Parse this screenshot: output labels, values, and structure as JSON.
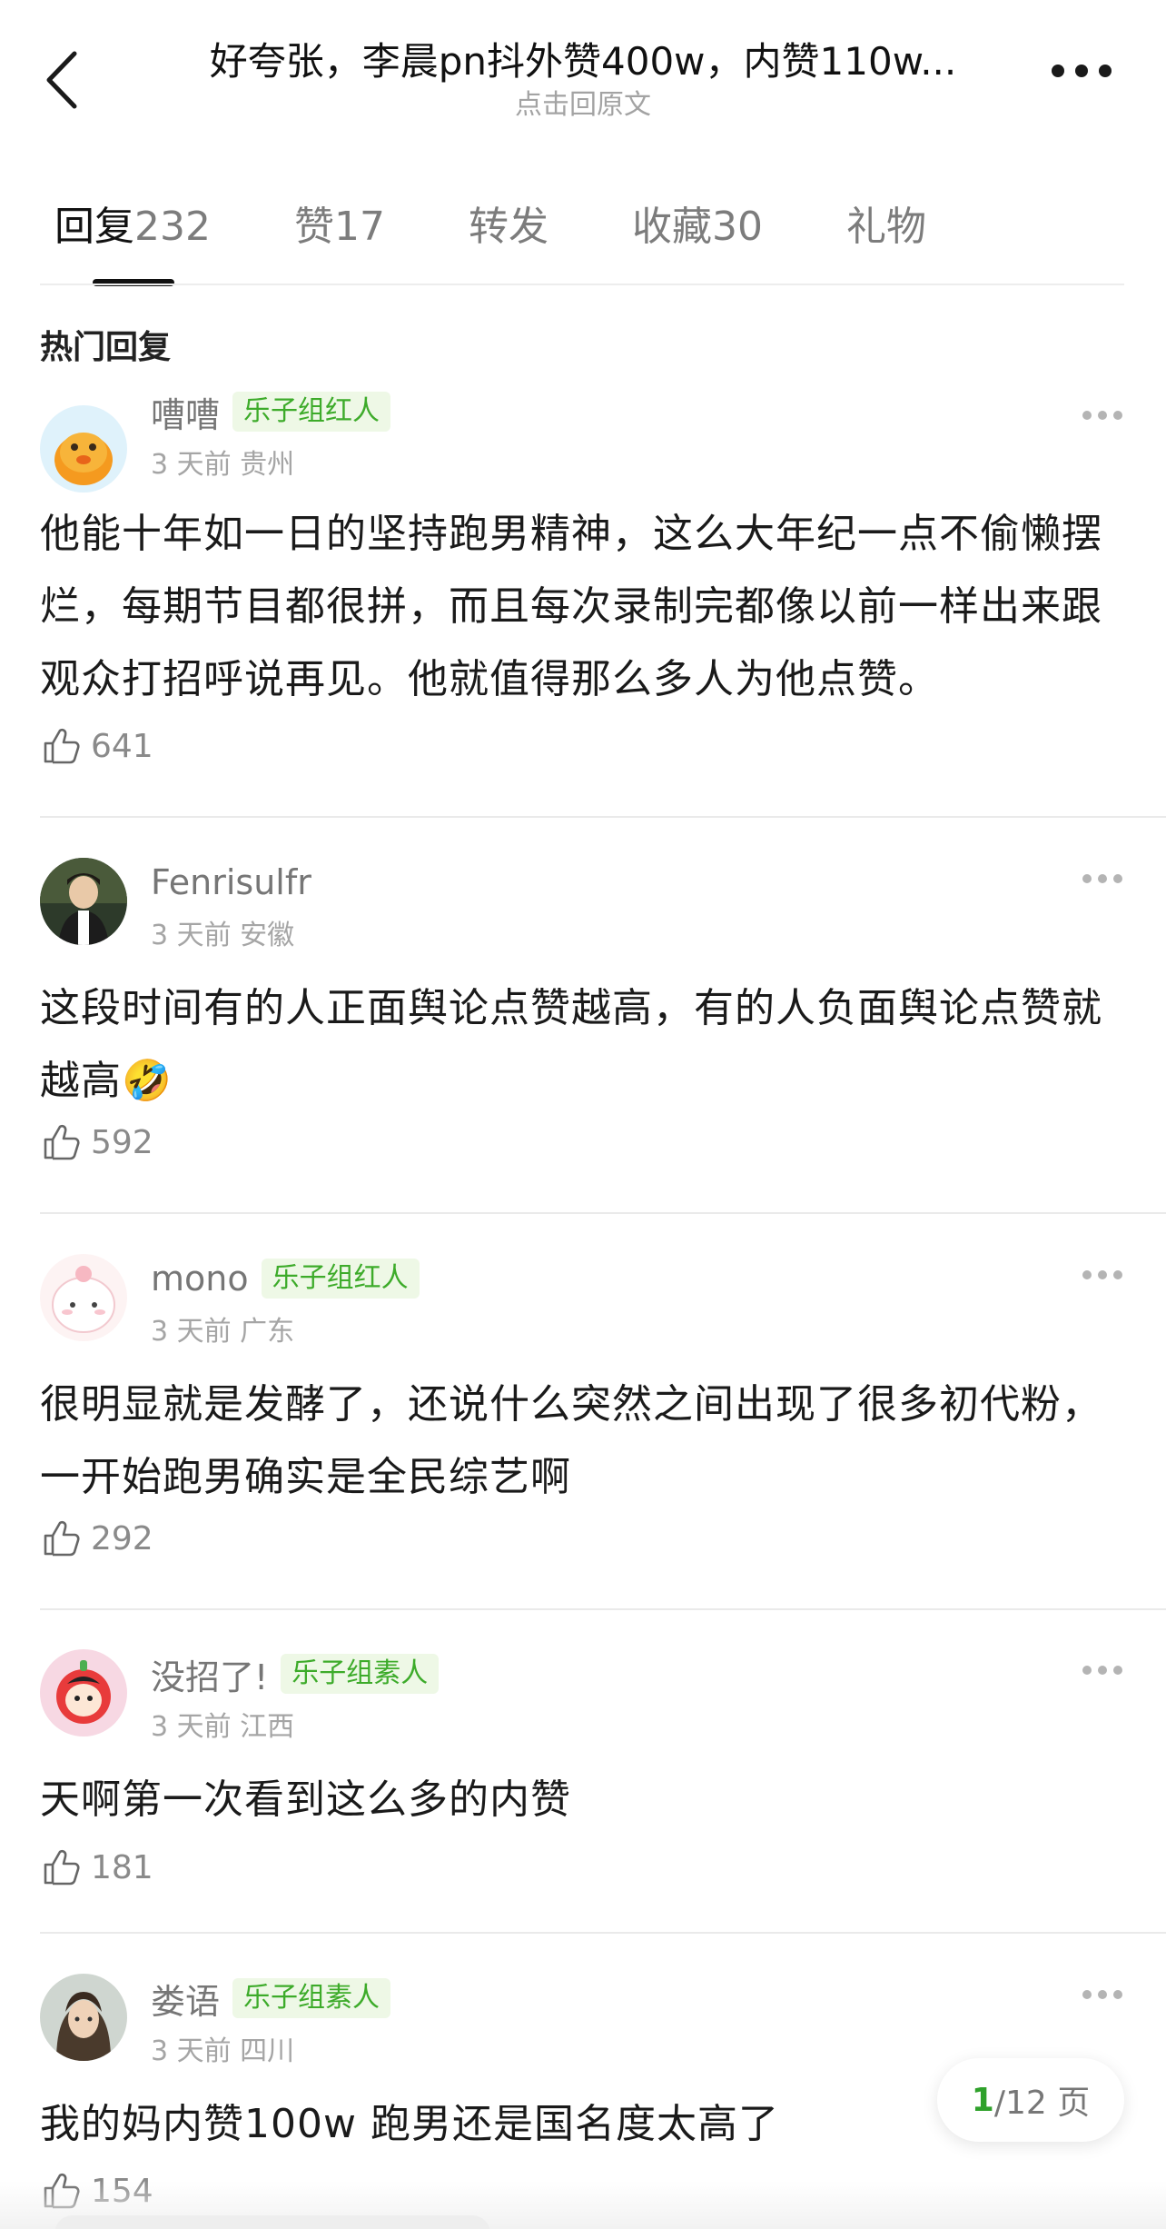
{
  "header": {
    "title": "好夸张，李晨pn抖外赞400w，内赞110w...",
    "subtitle": "点击回原文"
  },
  "tabs": [
    {
      "name": "回复",
      "count": "232"
    },
    {
      "name": "赞",
      "count": "17"
    },
    {
      "name": "转发",
      "count": ""
    },
    {
      "name": "收藏",
      "count": "30"
    },
    {
      "name": "礼物",
      "count": ""
    }
  ],
  "section_title": "热门回复",
  "comments": [
    {
      "username": "嘈嘈",
      "badge": "乐子组红人",
      "time_location": "3 天前  贵州",
      "text": "他能十年如一日的坚持跑男精神，这么大年纪一点不偷懒摆烂，每期节目都很拼，而且每次录制完都像以前一样出来跟观众打招呼说再见。他就值得那么多人为他点赞。",
      "likes": "641"
    },
    {
      "username": "Fenrisulfr",
      "badge": "",
      "time_location": "3 天前  安徽",
      "text": "这段时间有的人正面舆论点赞越高，有的人负面舆论点赞就越高🤣",
      "likes": "592"
    },
    {
      "username": "mono",
      "badge": "乐子组红人",
      "time_location": "3 天前  广东",
      "text": "很明显就是发酵了，还说什么突然之间出现了很多初代粉，一开始跑男确实是全民综艺啊",
      "likes": "292"
    },
    {
      "username": "没招了!",
      "badge": "乐子组素人",
      "time_location": "3 天前  江西",
      "text": "天啊第一次看到这么多的内赞",
      "likes": "181"
    },
    {
      "username": "娄语",
      "badge": "乐子组素人",
      "time_location": "3 天前  四川",
      "text": "我的妈内赞100w 跑男还是国名度太高了",
      "likes": "154"
    }
  ],
  "pagination": {
    "current": "1",
    "rest": "/12 页"
  },
  "colors": {
    "accent_green": "#3dab2a",
    "badge_bg": "#eef8e6"
  }
}
